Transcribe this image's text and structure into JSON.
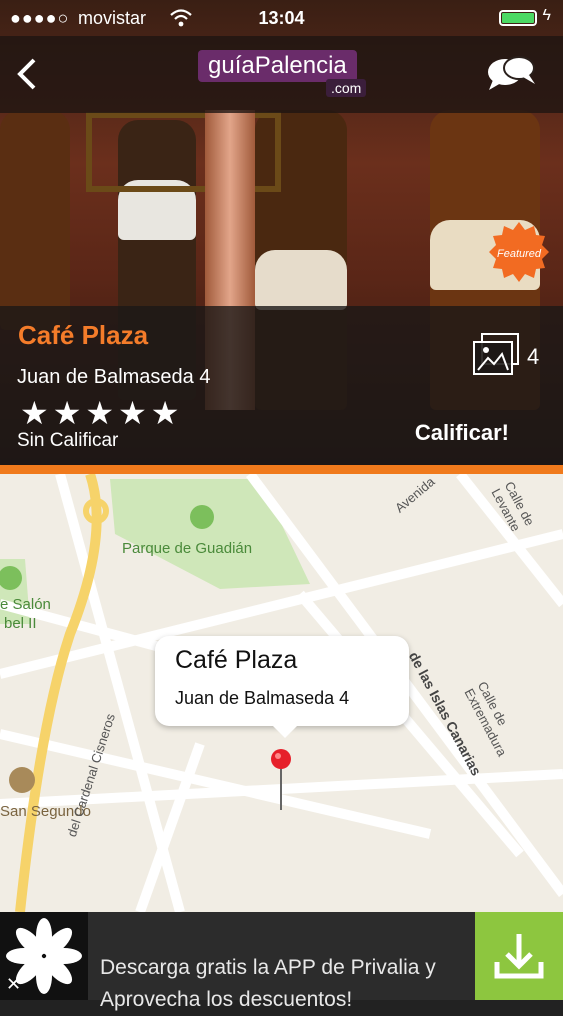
{
  "status_bar": {
    "signal_dots": "●●●●○",
    "carrier": "movistar",
    "time": "13:04",
    "battery_level": 1.0
  },
  "nav": {
    "logo_main": "guíaPalencia",
    "logo_suffix": ".com",
    "back_icon": "chevron-left-icon",
    "chat_icon": "chat-bubbles-icon"
  },
  "place": {
    "name": "Café Plaza",
    "address": "Juan de Balmaseda 4",
    "rating_stars": 5,
    "rating_status": "Sin Calificar",
    "rate_label": "Calificar!",
    "photo_count": "4",
    "badge": "Featured"
  },
  "map": {
    "callout_title": "Café Plaza",
    "callout_subtitle": "Juan de Balmaseda 4",
    "labels": {
      "parque": "Parque de Guadián",
      "salon_1": "e Salón",
      "salon_2": "bel II",
      "san_segundo": "San Segundo",
      "cardenal": "del Cardenal Cisneros",
      "islas": "de las Islas Canarias",
      "levante": "Calle de Levante",
      "extremadura": "Calle de Extremadura",
      "avenida": "Avenida"
    }
  },
  "ad": {
    "line1": "Descarga gratis la APP de Privalia y",
    "line2": "Aprovecha los descuentos!",
    "colors": {
      "download_bg": "#8dc63f"
    }
  },
  "colors": {
    "accent": "#f47c2a",
    "logo_bg": "#6a2c6a"
  }
}
